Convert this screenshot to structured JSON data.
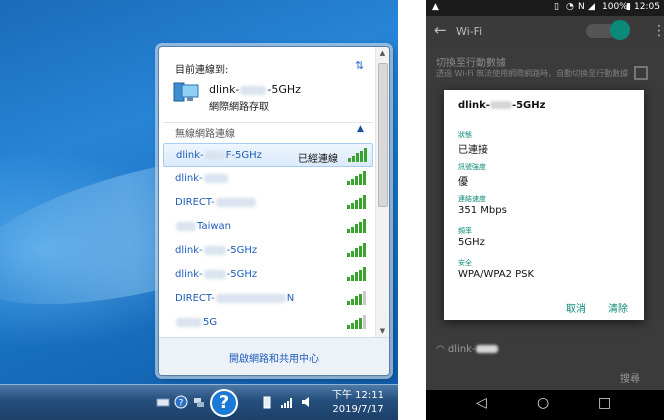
{
  "windows": {
    "flyout": {
      "currently_connected_label": "目前連線到:",
      "current_network": {
        "prefix": "dlink-",
        "suffix": "-5GHz",
        "type": "網際網路存取"
      },
      "section_title": "無線網路連線",
      "networks": [
        {
          "prefix": "dlink-",
          "suffix": "F-5GHz",
          "status": "已經連線",
          "signal": "full"
        },
        {
          "prefix": "dlink-",
          "suffix": "",
          "status": "",
          "signal": "full"
        },
        {
          "prefix": "DIRECT-",
          "suffix": "",
          "status": "",
          "signal": "full"
        },
        {
          "prefix": "",
          "suffix": "Taiwan",
          "status": "",
          "signal": "full"
        },
        {
          "prefix": "dlink-",
          "suffix": "-5GHz",
          "status": "",
          "signal": "full"
        },
        {
          "prefix": "dlink-",
          "suffix": "-5GHz",
          "status": "",
          "signal": "full"
        },
        {
          "prefix": "DIRECT-",
          "suffix": "N",
          "status": "",
          "signal": "weak"
        },
        {
          "prefix": "",
          "suffix": "5G",
          "status": "",
          "signal": "weak"
        }
      ],
      "footer_link": "開啟網路和共用中心"
    },
    "taskbar": {
      "clock_time": "下午 12:11",
      "clock_date": "2019/7/17"
    }
  },
  "android": {
    "status": {
      "battery": "100%",
      "time": "12:05"
    },
    "appbar_title": "Wi-Fi",
    "background": {
      "switch_title": "切換至行動數據",
      "switch_desc": "透過 Wi-Fi 無法使用網際網路時，自動切換至行動數據",
      "bottom_network": "dlink-",
      "search_button": "搜尋"
    },
    "dialog": {
      "title_prefix": "dlink-",
      "title_suffix": "-5GHz",
      "fields": [
        {
          "label": "狀態",
          "value": "已連接"
        },
        {
          "label": "訊號強度",
          "value": "優"
        },
        {
          "label": "連結速度",
          "value": "351 Mbps"
        },
        {
          "label": "頻率",
          "value": "5GHz"
        },
        {
          "label": "安全",
          "value": "WPA/WPA2 PSK"
        }
      ],
      "cancel": "取消",
      "forget": "清除"
    },
    "accent_color": "#0a8a78"
  }
}
